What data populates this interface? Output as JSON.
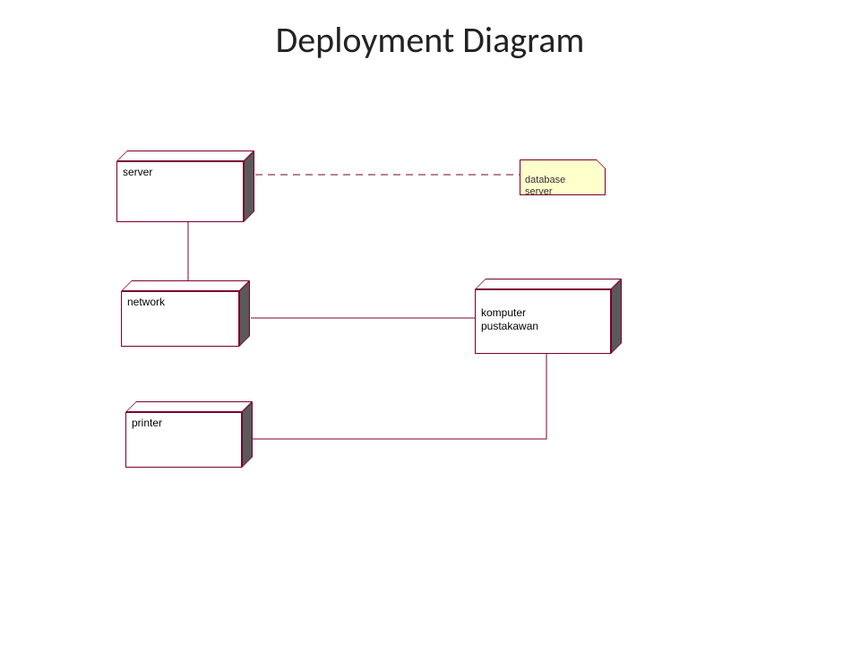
{
  "title": "Deployment Diagram",
  "nodes": {
    "server": {
      "label": "server"
    },
    "network": {
      "label": "network"
    },
    "komputer": {
      "label": "komputer\npustakawan"
    },
    "printer": {
      "label": "printer"
    }
  },
  "note": {
    "database": {
      "text": "database\nserver"
    }
  },
  "connections": [
    {
      "from": "server",
      "to": "database-note",
      "style": "dashed"
    },
    {
      "from": "server",
      "to": "network",
      "style": "solid"
    },
    {
      "from": "network",
      "to": "komputer",
      "style": "solid"
    },
    {
      "from": "komputer",
      "to": "printer",
      "style": "solid"
    }
  ]
}
